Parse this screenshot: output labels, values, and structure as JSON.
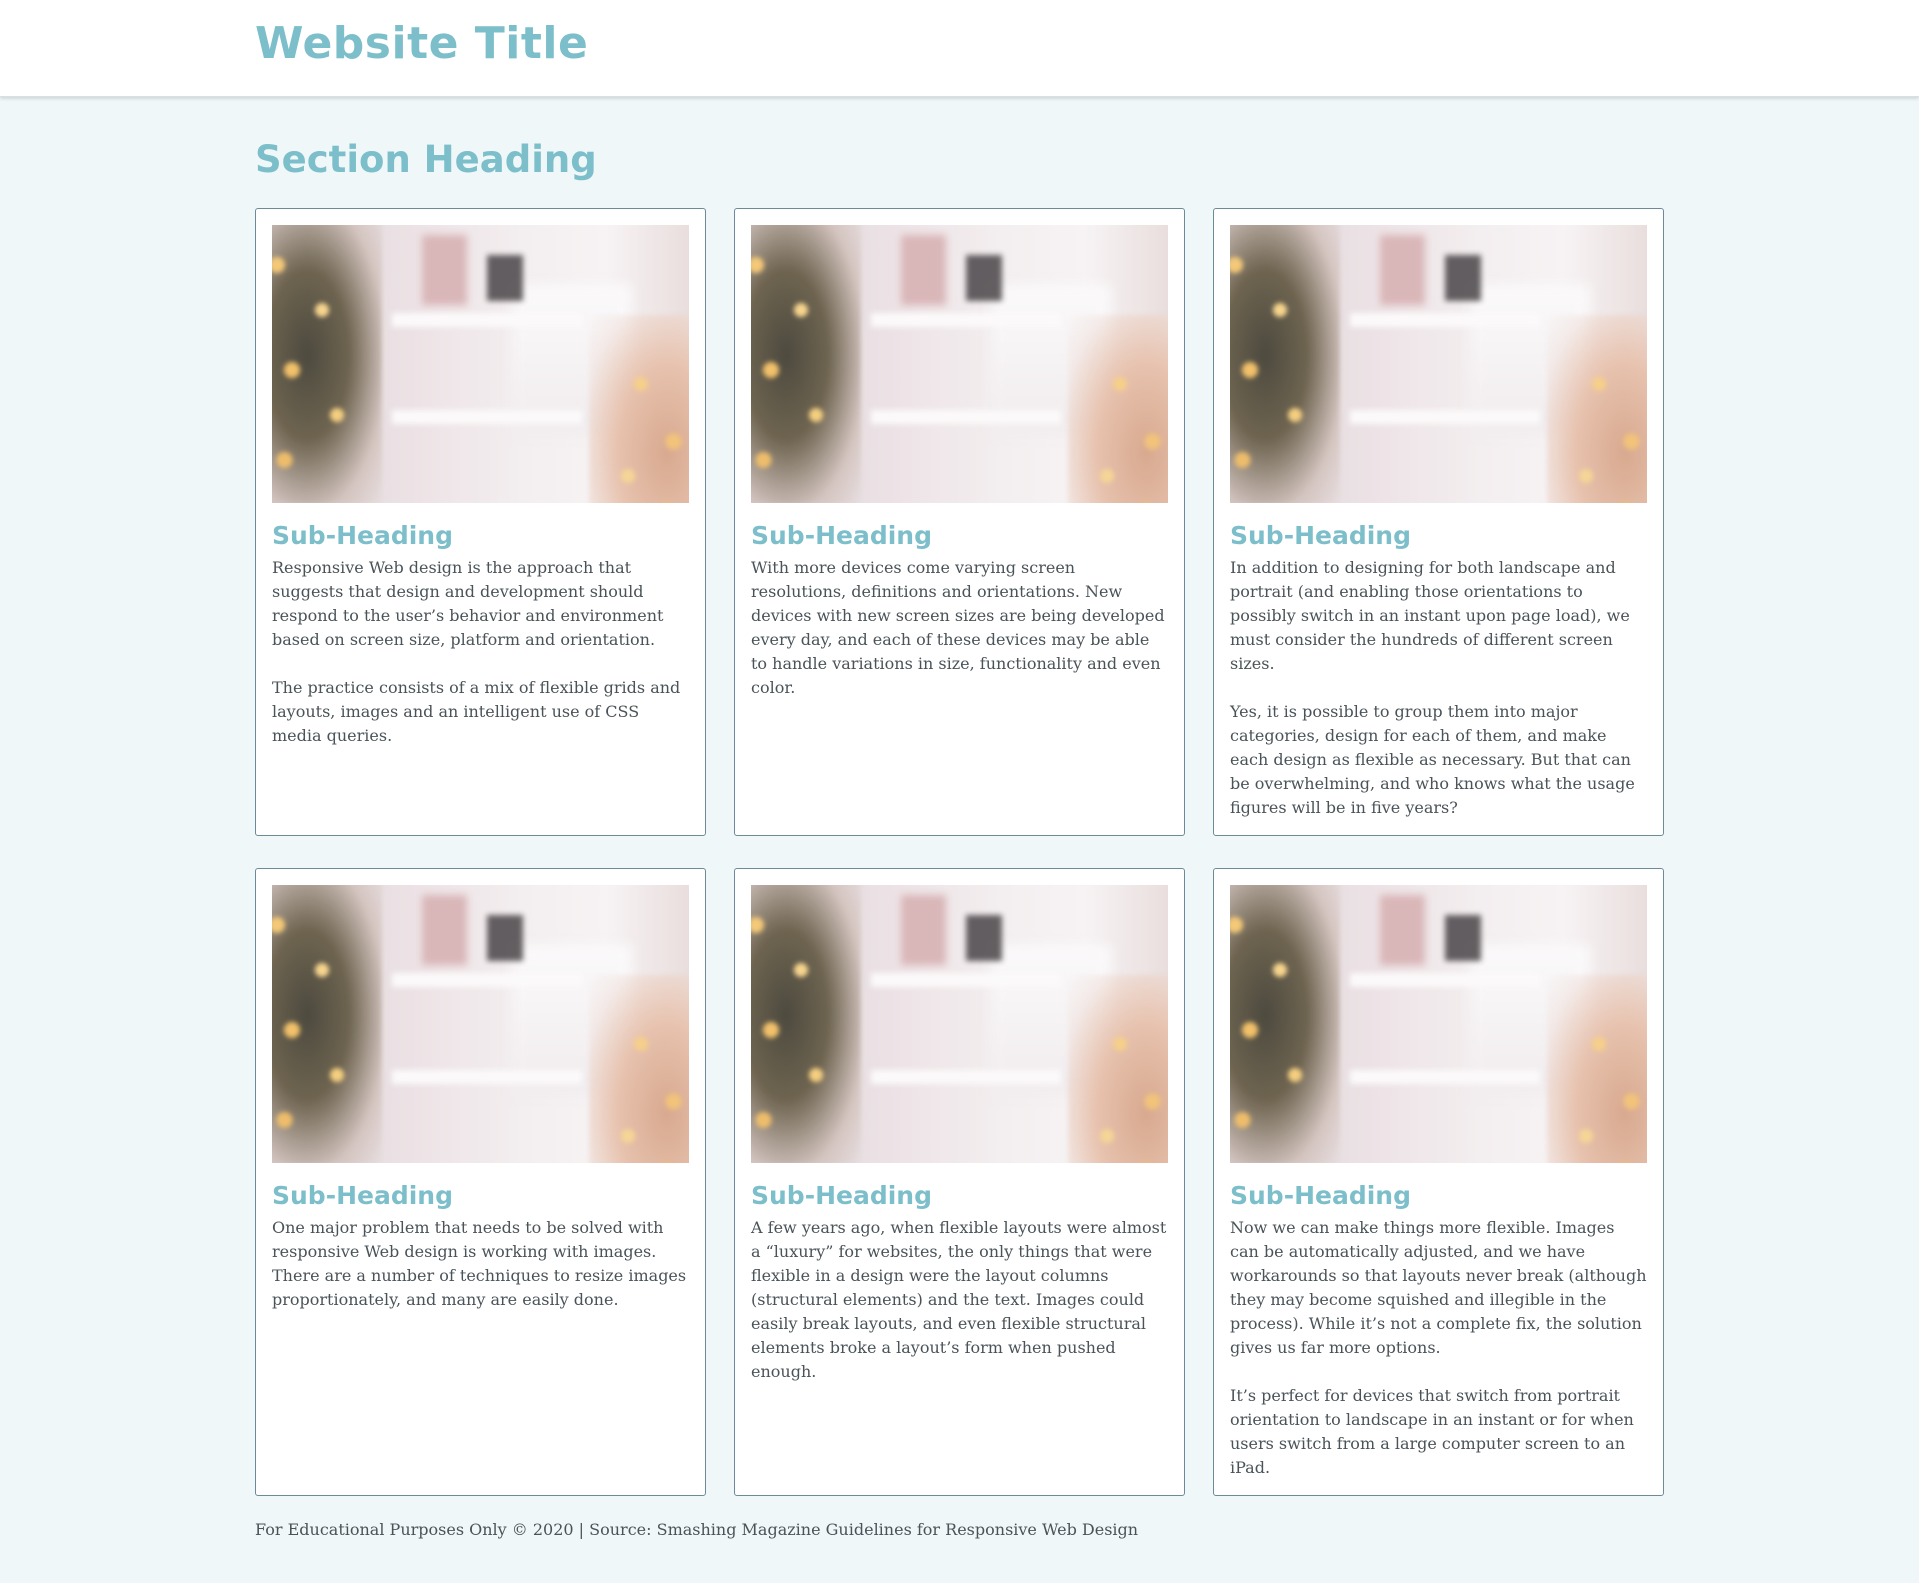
{
  "header": {
    "site_title": "Website Title"
  },
  "main": {
    "section_heading": "Section Heading",
    "cards": [
      {
        "subheading": "Sub-Heading",
        "paragraphs": [
          "Responsive Web design is the approach that suggests that design and development should respond to the user’s behavior and environment based on screen size, platform and orientation.",
          "The practice consists of a mix of flexible grids and layouts, images and an intelligent use of CSS media queries."
        ]
      },
      {
        "subheading": "Sub-Heading",
        "paragraphs": [
          "With more devices come varying screen resolutions, definitions and orientations. New devices with new screen sizes are being developed every day, and each of these devices may be able to handle variations in size, functionality and even color."
        ]
      },
      {
        "subheading": "Sub-Heading",
        "paragraphs": [
          "In addition to designing for both landscape and portrait (and enabling those orientations to possibly switch in an instant upon page load), we must consider the hundreds of different screen sizes.",
          "Yes, it is possible to group them into major categories, design for each of them, and make each design as flexible as necessary. But that can be overwhelming, and who knows what the usage figures will be in five years?"
        ]
      },
      {
        "subheading": "Sub-Heading",
        "paragraphs": [
          "One major problem that needs to be solved with responsive Web design is working with images. There are a number of techniques to resize images proportionately, and many are easily done."
        ]
      },
      {
        "subheading": "Sub-Heading",
        "paragraphs": [
          "A few years ago, when flexible layouts were almost a “luxury” for websites, the only things that were flexible in a design were the layout columns (structural elements) and the text. Images could easily break layouts, and even flexible structural elements broke a layout’s form when pushed enough."
        ]
      },
      {
        "subheading": "Sub-Heading",
        "paragraphs": [
          "Now we can make things more flexible. Images can be automatically adjusted, and we have workarounds so that layouts never break (although they may become squished and illegible in the process). While it’s not a complete fix, the solution gives us far more options.",
          "It’s perfect for devices that switch from portrait orientation to landscape in an instant or for when users switch from a large computer screen to an iPad."
        ]
      }
    ]
  },
  "footer": {
    "text": "For Educational Purposes Only © 2020 | Source: Smashing Magazine Guidelines for Responsive Web Design"
  },
  "colors": {
    "accent": "#7cbfcb",
    "page_background": "#eff7f8",
    "card_border": "#6d8a9a",
    "body_text": "#4a5358"
  }
}
